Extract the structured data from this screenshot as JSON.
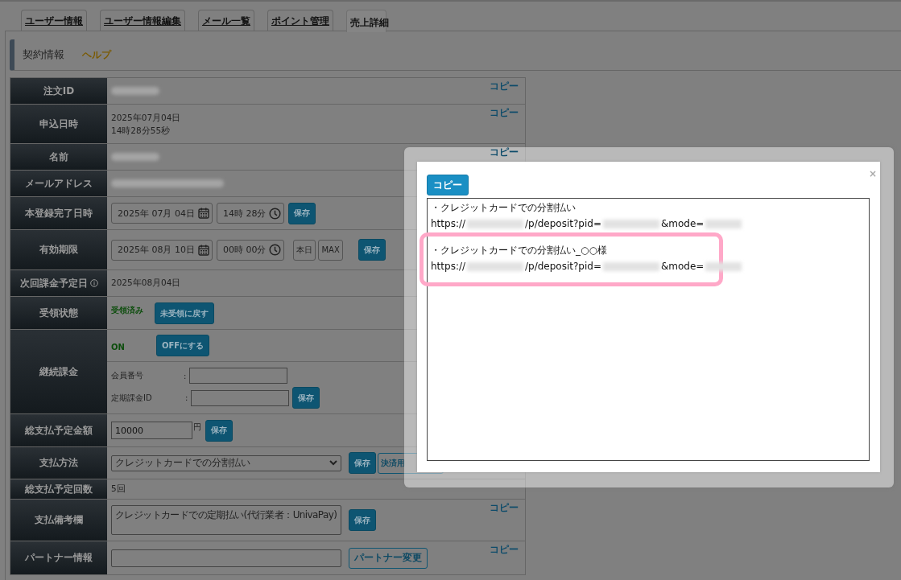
{
  "tabs": [
    {
      "label": "ユーザー情報",
      "selected": false
    },
    {
      "label": "ユーザー情報編集",
      "selected": false
    },
    {
      "label": "メール一覧",
      "selected": false
    },
    {
      "label": "ポイント管理",
      "selected": false
    },
    {
      "label": "売上詳細",
      "selected": true
    }
  ],
  "section": {
    "title": "契約情報",
    "help_link": "ヘルプ"
  },
  "rows": [
    {
      "kind": "redacted",
      "label": "注文ID",
      "copy": "コピー"
    },
    {
      "kind": "lines",
      "label": "申込日時",
      "lines": [
        "2025年07月04日",
        "14時28分55秒"
      ],
      "copy": "コピー"
    },
    {
      "kind": "redacted",
      "label": "名前",
      "copy": "コピー"
    },
    {
      "kind": "redacted",
      "label": "メールアドレス"
    },
    {
      "kind": "datetime",
      "label": "本登録完了日時",
      "date": "2025年 07月 04日",
      "time": "14時 28分",
      "save": "保存"
    },
    {
      "kind": "datetime",
      "label": "有効期限",
      "date": "2025年 08月 10日",
      "time": "00時 00分",
      "quick": [
        "本日",
        "MAX"
      ],
      "save": "保存"
    },
    {
      "kind": "lines",
      "label": "次回課金予定日",
      "info": true,
      "lines": [
        "2025年08月04日"
      ]
    },
    {
      "kind": "status",
      "label": "受領状態",
      "status": "受領済み",
      "button": "未受領に戻す"
    },
    {
      "kind": "subscription",
      "label": "継続課金",
      "status": "ON",
      "button": "OFFにする",
      "fields": [
        {
          "label": "会員番号",
          "sep": ":"
        },
        {
          "label": "定期課金ID",
          "sep": ":"
        }
      ],
      "save": "保存"
    },
    {
      "kind": "amount",
      "label": "総支払予定金額",
      "value": "10000",
      "unit": "円",
      "save": "保存"
    },
    {
      "kind": "select",
      "label": "支払方法",
      "value": "クレジットカードでの分割払い",
      "save": "保存",
      "extra": "決済用"
    },
    {
      "kind": "lines",
      "label": "総支払予定回数",
      "lines": [
        "5回"
      ]
    },
    {
      "kind": "textarea",
      "label": "支払備考欄",
      "value": "クレジットカードでの定期払い(代行業者：UnivaPay)",
      "save": "保存",
      "copy": "コピー"
    },
    {
      "kind": "partner",
      "label": "パートナー情報",
      "button": "パートナー変更",
      "copy": "コピー"
    }
  ],
  "modal": {
    "copy_button": "コピー",
    "close": "×",
    "entries": [
      {
        "heading": "・クレジットカードでの分割払い",
        "url_parts": [
          "https://",
          "/p/deposit?pid=",
          "&mode="
        ],
        "highlighted": false
      },
      {
        "heading": "・クレジットカードでの分割払い_○○様",
        "url_parts": [
          "https://",
          "/p/deposit?pid=",
          "&mode="
        ],
        "highlighted": true
      }
    ]
  }
}
